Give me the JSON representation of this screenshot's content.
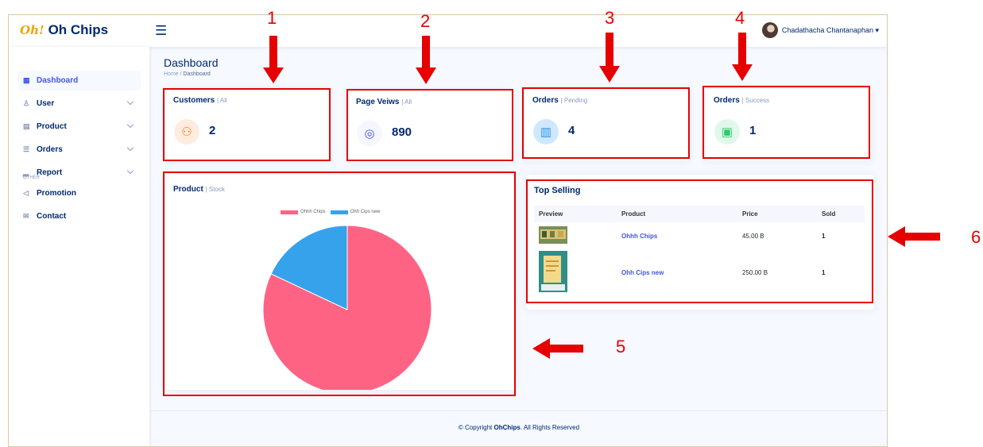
{
  "app": {
    "logo_mark": "Oh!",
    "name": "Oh Chips"
  },
  "header": {
    "menu_icon": "hamburger-icon",
    "user_name": "Chadathacha Chantanaphan ▾"
  },
  "sidebar": {
    "items": [
      {
        "label": "Dashboard",
        "icon": "grid-icon",
        "glyph": "▦",
        "active": true
      },
      {
        "label": "User",
        "icon": "person-icon",
        "glyph": "♙"
      },
      {
        "label": "Product",
        "icon": "menu-button-icon",
        "glyph": "▤"
      },
      {
        "label": "Orders",
        "icon": "layout-text-icon",
        "glyph": "☰"
      },
      {
        "label": "Report",
        "icon": "bar-chart-icon",
        "glyph": "▂"
      }
    ],
    "heading": "OTHER",
    "other_items": [
      {
        "label": "Promotion",
        "icon": "megaphone-icon",
        "glyph": "◁"
      },
      {
        "label": "Contact",
        "icon": "envelope-icon",
        "glyph": "✉"
      }
    ]
  },
  "page": {
    "title": "Dashboard",
    "breadcrumb_home": "Home",
    "breadcrumb_sep": "/",
    "breadcrumb_current": "Dashboard"
  },
  "stats": [
    {
      "title": "Customers",
      "sub": "| All",
      "value": "2",
      "icon": "people-icon",
      "glyph": "⚇",
      "bg": "#ffecdf",
      "fg": "#ff771d"
    },
    {
      "title": "Page Veiws",
      "sub": "| All",
      "value": "890",
      "icon": "eye-icon",
      "glyph": "◎",
      "bg": "#f6f6fe",
      "fg": "#4154f1"
    },
    {
      "title": "Orders",
      "sub": "| Pending",
      "value": "4",
      "icon": "basket-icon",
      "glyph": "▥",
      "bg": "#cfe8ff",
      "fg": "#2b95e8"
    },
    {
      "title": "Orders",
      "sub": "| Success",
      "value": "1",
      "icon": "cash-icon",
      "glyph": "▣",
      "bg": "#e0f8e9",
      "fg": "#2eca6a"
    }
  ],
  "product_card": {
    "title": "Product",
    "sub": "| Stock"
  },
  "chart_data": {
    "type": "pie",
    "categories": [
      "Ohhh Chips",
      "Ohh Cips new"
    ],
    "values": [
      82,
      18
    ],
    "colors": [
      "#ff6384",
      "#36a2eb"
    ],
    "legend": "top"
  },
  "top_selling": {
    "title": "Top Selling",
    "headers": [
      "Preview",
      "Product",
      "Price",
      "Sold"
    ],
    "rows": [
      {
        "product": "Ohhh Chips",
        "price": "45.00 B",
        "sold": "1"
      },
      {
        "product": "Ohh Cips new",
        "price": "250.00 B",
        "sold": "1"
      }
    ]
  },
  "footer": {
    "prefix": "© Copyright ",
    "brand": "OhChips",
    "suffix": ". All Rights Reserved"
  },
  "annotations": [
    "1",
    "2",
    "3",
    "4",
    "5",
    "6"
  ],
  "annotation_color": "#e60000"
}
